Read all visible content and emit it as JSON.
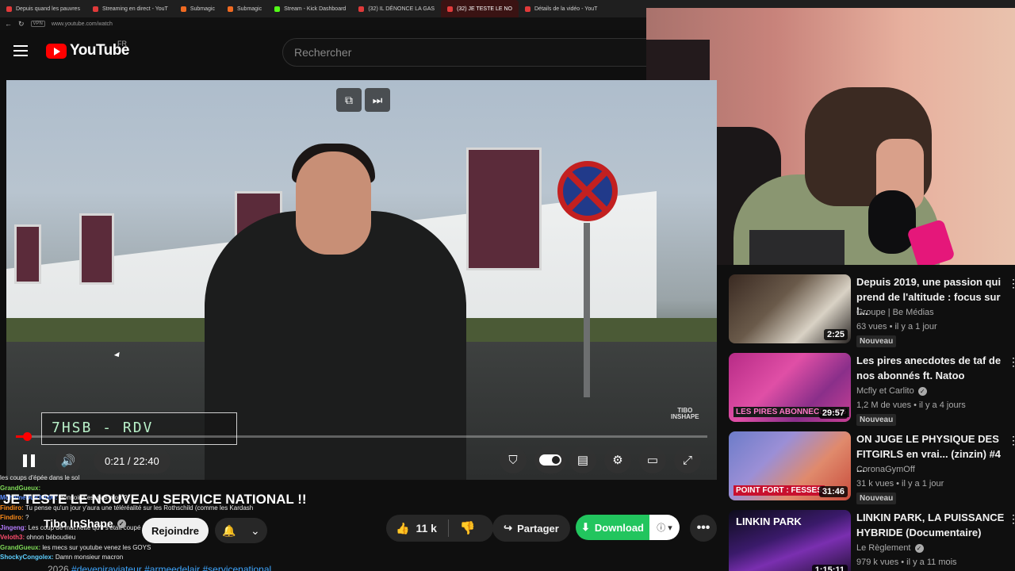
{
  "browser": {
    "tabs": [
      {
        "label": "Depuis quand les pauvres",
        "color": "#e03a3a"
      },
      {
        "label": "Streaming en direct - YouT",
        "color": "#e03a3a"
      },
      {
        "label": "Submagic",
        "color": "#f06a21"
      },
      {
        "label": "Submagic",
        "color": "#f06a21"
      },
      {
        "label": "Stream - Kick Dashboard",
        "color": "#53fc18"
      },
      {
        "label": "(32) IL DÉNONCE LA GAS",
        "color": "#e03a3a"
      },
      {
        "label": "(32) JE TESTE LE NO",
        "color": "#e03a3a",
        "active": true
      },
      {
        "label": "Détails de la vidéo - YouT",
        "color": "#e03a3a"
      }
    ],
    "url": "www.youtube.com/watch",
    "vpn_badge": "VPN"
  },
  "header": {
    "logo_text": "YouTube",
    "country": "FR",
    "search_placeholder": "Rechercher"
  },
  "player": {
    "lower_third": "7HSB - RDV",
    "watermark_line1": "TIBO",
    "watermark_line2": "INSHAPE",
    "time": "0:21 / 22:40",
    "progress_fraction": 0.016,
    "icons": {
      "pause": "pause-icon",
      "volume": "volume-icon",
      "miniplayer": "miniplayer-icon",
      "next": "next-icon"
    }
  },
  "video": {
    "title": "JE TESTE LE NOUVEAU SERVICE NATIONAL !!",
    "channel": "Tibo InShape",
    "join_label": "Rejoindre",
    "likes": "11 k",
    "share_label": "Partager",
    "download_label": "Download",
    "desc_date": "2026",
    "desc_tags": "#deveniraviateur #armeedelair #servicenational"
  },
  "chat": [
    {
      "user": "",
      "text": "les coups d'épée dans le sol"
    },
    {
      "user": "GrandGueux:",
      "text": ""
    },
    {
      "user": "MohameDu930000:",
      "text": "Bonsoir il est pas mort ?"
    },
    {
      "user": "",
      "text": ""
    },
    {
      "user": "Findiro:",
      "text": "Tu pense qu'un jour y'aura une téléréalité sur les Rothschild (comme les Kardash"
    },
    {
      "user": "Findiro:",
      "text": "?"
    },
    {
      "user": "Jingeng:",
      "text": "Les coup de machette qu'il s'était coupé ?"
    },
    {
      "user": "Veloth3:",
      "text": "ohnon béboudieu"
    },
    {
      "user": "GrandGueux:",
      "text": "les mecs sur youtube venez les GOYS"
    },
    {
      "user": "ShockyCongolex:",
      "text": "Damn monsieur macron"
    }
  ],
  "recommendations": [
    {
      "title": "Depuis 2019, une passion qui prend de l'altitude : focus sur l...",
      "channel": "Groupe | Be Médias",
      "verified": false,
      "meta": "63 vues • il y a 1 jour",
      "duration": "2:25",
      "badge": "Nouveau"
    },
    {
      "title": "Les pires anecdotes de taf de nos abonnés ft. Natoo",
      "channel": "Mcfly et Carlito",
      "verified": true,
      "meta": "1,2 M de vues • il y a 4 jours",
      "duration": "29:57",
      "badge": "Nouveau",
      "thumb_text": "LES PIRES ABONNECDOTES"
    },
    {
      "title": "ON JUGE LE PHYSIQUE DES FITGIRLS en vrai... (zinzin) #4 ...",
      "channel": "CoronaGymOff",
      "verified": false,
      "meta": "31 k vues • il y a 1 jour",
      "duration": "31:46",
      "badge": "Nouveau",
      "thumb_text": "POINT FORT : FESSES"
    },
    {
      "title": "LINKIN PARK, LA PUISSANCE HYBRIDE (Documentaire)",
      "channel": "Le Règlement",
      "verified": true,
      "meta": "979 k vues • il y a 11 mois",
      "duration": "1:15:11",
      "badge": "",
      "thumb_text": "LINKIN PARK"
    }
  ]
}
